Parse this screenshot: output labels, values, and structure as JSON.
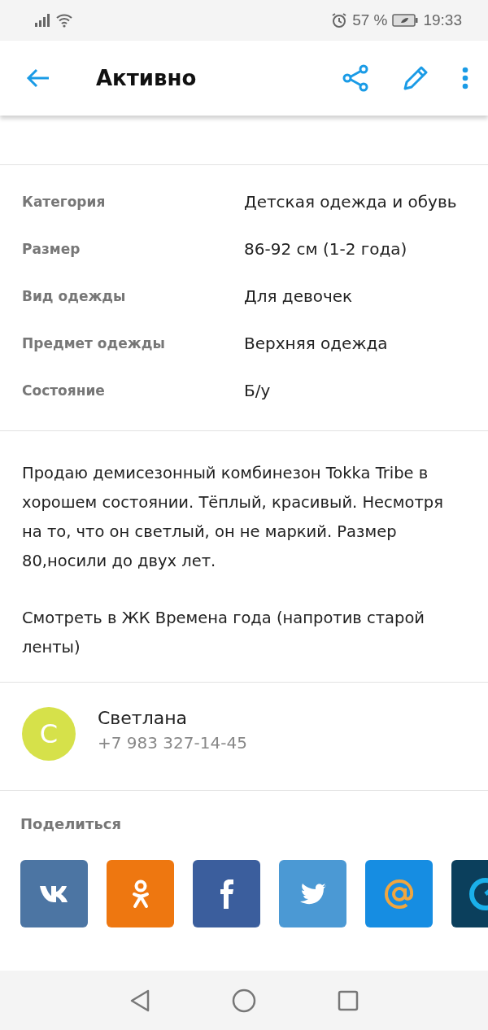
{
  "status_bar": {
    "battery_text": "57 %",
    "time": "19:33"
  },
  "header": {
    "title": "Активно"
  },
  "details": [
    {
      "label": "Категория",
      "value": "Детская одежда и обувь"
    },
    {
      "label": "Размер",
      "value": "86-92 см (1-2 года)"
    },
    {
      "label": "Вид одежды",
      "value": "Для девочек"
    },
    {
      "label": "Предмет одежды",
      "value": "Верхняя одежда"
    },
    {
      "label": "Состояние",
      "value": "Б/у"
    }
  ],
  "description": [
    "Продаю демисезонный комбинезон Tokka Tribe в хорошем состоянии. Тёплый, красивый. Несмотря на то, что он светлый, он не маркий. Размер 80,носили до двух лет.",
    "Смотреть в ЖК Времена года (напротив старой ленты)"
  ],
  "contact": {
    "initial": "С",
    "name": "Светлана",
    "phone": "+7 983 327-14-45"
  },
  "share": {
    "title": "Поделиться",
    "buttons": [
      {
        "kind": "vk",
        "color": "#4c75a3"
      },
      {
        "kind": "ok",
        "color": "#ee7710"
      },
      {
        "kind": "facebook",
        "color": "#3b5e9d"
      },
      {
        "kind": "twitter",
        "color": "#4b99d4"
      },
      {
        "kind": "mail",
        "color": "#168de2"
      },
      {
        "kind": "clock",
        "color": "#0b3f5c"
      }
    ]
  }
}
